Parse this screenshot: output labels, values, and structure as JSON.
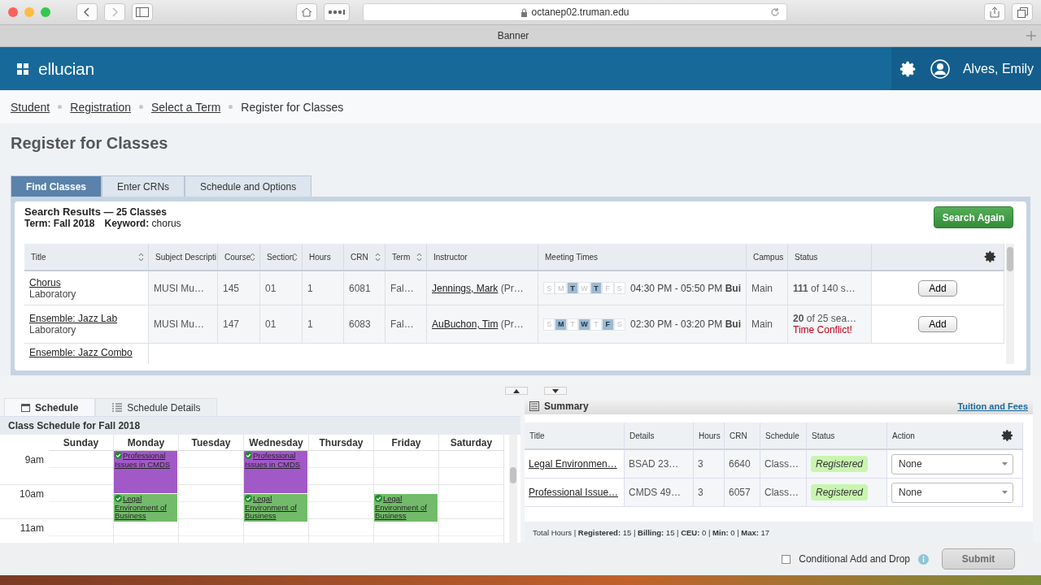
{
  "browser": {
    "url": "octanep02.truman.edu",
    "tab": "Banner"
  },
  "header": {
    "brand": "ellucian",
    "user": "Alves, Emily"
  },
  "breadcrumbs": [
    {
      "label": "Student",
      "link": true
    },
    {
      "label": "Registration",
      "link": true
    },
    {
      "label": "Select a Term",
      "link": true
    },
    {
      "label": "Register for Classes",
      "link": false
    }
  ],
  "page_title": "Register for Classes",
  "tabs": [
    {
      "label": "Find Classes",
      "selected": true
    },
    {
      "label": "Enter CRNs",
      "selected": false
    },
    {
      "label": "Schedule and Options",
      "selected": false
    }
  ],
  "results": {
    "title": "Search Results",
    "count": "— 25 Classes",
    "term_label": "Term:",
    "term": "Fall 2018",
    "keyword_label": "Keyword:",
    "keyword": "chorus",
    "search_again": "Search Again",
    "columns": [
      {
        "label": "Title",
        "sortable": true
      },
      {
        "label": "Subject Descripti",
        "sortable": false
      },
      {
        "label": "Course",
        "sortable": true
      },
      {
        "label": "Section",
        "sortable": true
      },
      {
        "label": "Hours",
        "sortable": false
      },
      {
        "label": "CRN",
        "sortable": true
      },
      {
        "label": "Term",
        "sortable": true
      },
      {
        "label": "Instructor",
        "sortable": false
      },
      {
        "label": "Meeting Times",
        "sortable": false
      },
      {
        "label": "Campus",
        "sortable": false
      },
      {
        "label": "Status",
        "sortable": false
      }
    ],
    "rows": [
      {
        "title": "Chorus",
        "subtitle": "Laboratory",
        "subject": "MUSI Mu…",
        "course": "145",
        "section": "01",
        "hours": "1",
        "crn": "6081",
        "term": "Fal…",
        "instructor": "Jennings, Mark",
        "instructor_rest": "(Pr…",
        "days": [
          {
            "letter": "S",
            "selected": false
          },
          {
            "letter": "M",
            "selected": false
          },
          {
            "letter": "T",
            "selected": true
          },
          {
            "letter": "W",
            "selected": false
          },
          {
            "letter": "T",
            "selected": true
          },
          {
            "letter": "F",
            "selected": false
          },
          {
            "letter": "S",
            "selected": false
          }
        ],
        "time": "04:30 PM - 05:50 PM",
        "building": "Bui",
        "campus": "Main",
        "seats": "111",
        "seats_rest": "of 140 s…",
        "action": "Add"
      },
      {
        "title": "Ensemble: Jazz Lab",
        "subtitle": "Laboratory",
        "subject": "MUSI Mu…",
        "course": "147",
        "section": "01",
        "hours": "1",
        "crn": "6083",
        "term": "Fal…",
        "instructor": "AuBuchon, Tim",
        "instructor_rest": "(Pr…",
        "days": [
          {
            "letter": "S",
            "selected": false
          },
          {
            "letter": "M",
            "selected": true
          },
          {
            "letter": "T",
            "selected": false
          },
          {
            "letter": "W",
            "selected": true
          },
          {
            "letter": "T",
            "selected": false
          },
          {
            "letter": "F",
            "selected": true
          },
          {
            "letter": "S",
            "selected": false
          }
        ],
        "time": "02:30 PM - 03:20 PM",
        "building": "Bui",
        "campus": "Main",
        "seats": "20",
        "seats_rest": "of 25 sea…",
        "conflict": "Time Conflict!",
        "action": "Add"
      },
      {
        "title": "Ensemble: Jazz Combo"
      }
    ]
  },
  "schedule": {
    "tabs": [
      {
        "label": "Schedule",
        "selected": true
      },
      {
        "label": "Schedule Details",
        "selected": false
      }
    ],
    "title": "Class Schedule for Fall 2018",
    "days": [
      "Sunday",
      "Monday",
      "Tuesday",
      "Wednesday",
      "Thursday",
      "Friday",
      "Saturday"
    ],
    "rows": [
      {
        "time": "9am",
        "cells": [
          {
            "kind": "empty"
          },
          {
            "kind": "event",
            "title": "Professional Issues in CMDS",
            "color": "#a259c8",
            "registered": true,
            "starts_half": false
          },
          {
            "kind": "empty"
          },
          {
            "kind": "event",
            "title": "Professional Issues in CMDS",
            "color": "#a259c8",
            "registered": true,
            "starts_half": false
          },
          {
            "kind": "empty"
          },
          {
            "kind": "empty"
          },
          {
            "kind": "empty"
          }
        ]
      },
      {
        "time": "10am",
        "cells": [
          {
            "kind": "empty"
          },
          {
            "kind": "event",
            "title": "Legal Environment of Business",
            "color": "#72bb6a",
            "registered": true,
            "starts_half": true
          },
          {
            "kind": "empty"
          },
          {
            "kind": "event",
            "title": "Legal Environment of Business",
            "color": "#72bb6a",
            "registered": true,
            "starts_half": true
          },
          {
            "kind": "empty"
          },
          {
            "kind": "event",
            "title": "Legal Environment of Business",
            "color": "#72bb6a",
            "registered": true,
            "starts_half": true
          },
          {
            "kind": "empty"
          }
        ]
      },
      {
        "time": "11am",
        "cells": [
          {
            "kind": "empty"
          },
          {
            "kind": "empty"
          },
          {
            "kind": "empty"
          },
          {
            "kind": "empty"
          },
          {
            "kind": "empty"
          },
          {
            "kind": "empty"
          },
          {
            "kind": "empty"
          }
        ]
      }
    ]
  },
  "summary": {
    "title": "Summary",
    "link": "Tuition and Fees",
    "columns": [
      "Title",
      "Details",
      "Hours",
      "CRN",
      "Schedule",
      "Status",
      "Action"
    ],
    "rows": [
      {
        "title": "Legal Environmen…",
        "details": "BSAD 23…",
        "hours": "3",
        "crn": "6640",
        "schedule_type": "Class…",
        "status": "Registered",
        "action": "None"
      },
      {
        "title": "Professional Issue…",
        "details": "CMDS 49…",
        "hours": "3",
        "crn": "6057",
        "schedule_type": "Class…",
        "status": "Registered",
        "action": "None"
      }
    ],
    "totals": "Total Hours | **Registered:** 15 | **Billing:** 15 | **CEU:** 0 | **Min:** 0 | **Max:** 17"
  },
  "footer": {
    "conditional": {
      "label": "Conditional Add and Drop",
      "checked": false
    },
    "submit": {
      "label": "Submit",
      "disabled": true
    }
  }
}
